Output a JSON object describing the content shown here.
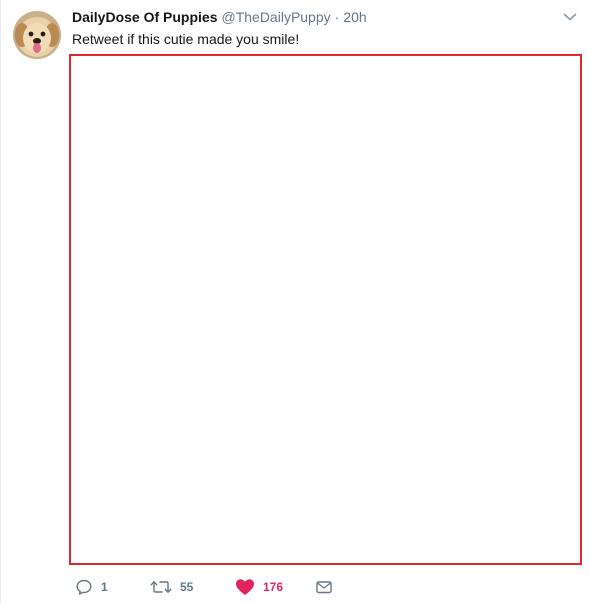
{
  "tweet": {
    "author": {
      "name": "DailyDose Of Puppies",
      "handle": "@TheDailyPuppy",
      "separator": "·",
      "time": "20h",
      "avatar_icon": "puppy-avatar"
    },
    "text": "Retweet if this cutie made you smile!",
    "media": {
      "border_color": "#e0282e"
    },
    "actions": {
      "reply": {
        "icon": "reply-icon",
        "count": "1"
      },
      "retweet": {
        "icon": "retweet-icon",
        "count": "55"
      },
      "like": {
        "icon": "heart-icon",
        "count": "176",
        "liked": true,
        "color": "#e0245e"
      },
      "dm": {
        "icon": "envelope-icon"
      }
    },
    "menu": {
      "icon": "chevron-down-icon"
    }
  }
}
